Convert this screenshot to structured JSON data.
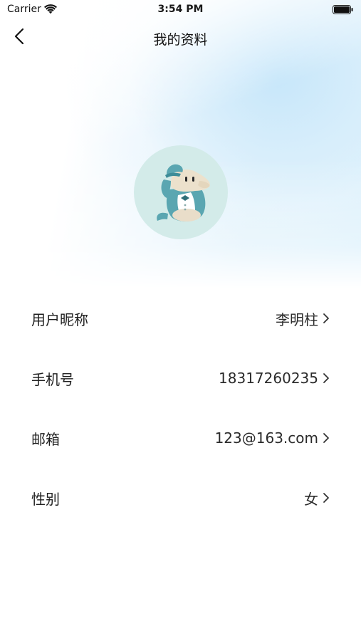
{
  "status_bar": {
    "carrier": "Carrier",
    "time": "3:54 PM",
    "wifi_icon": "wifi-icon",
    "battery_icon": "battery-icon"
  },
  "nav": {
    "title": "我的资料",
    "back_icon": "chevron-left-icon"
  },
  "avatar": {
    "icon": "dolphin-mascot-avatar",
    "bg_color": "#d3ebe9"
  },
  "info": {
    "rows": [
      {
        "label": "用户昵称",
        "value": "李明柱"
      },
      {
        "label": "手机号",
        "value": "18317260235"
      },
      {
        "label": "邮箱",
        "value": "123@163.com"
      },
      {
        "label": "性别",
        "value": "女"
      }
    ]
  },
  "colors": {
    "accent_light_blue": "#d6eefb",
    "text": "#1f1f1f"
  }
}
